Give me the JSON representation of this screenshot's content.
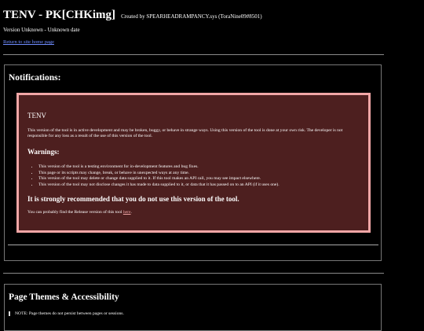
{
  "header": {
    "title": "TENV - PK[CHKimg]",
    "creator": "Created by SPEARHEADRAMPANCY.sys (ToraNine09#8501)",
    "version": "Version Unknown - Unknown date",
    "home_link": "Return to site home page"
  },
  "notifications": {
    "title": "Notifications:",
    "warning": {
      "heading": "TENV",
      "intro": "This version of the tool is in active development and may be broken, buggy, or behave in strange ways. Using this version of the tool is done at your own risk. The developer is not responsible for any loss as a result of the use of this version of the tool.",
      "warnings_title": "Warnings:",
      "items": [
        "This version of the tool is a testing environment for in-development features and bug fixes.",
        "This page or its scripts may change, break, or behave in unexpected ways at any time.",
        "This version of the tool may delete or change data supplied to it. If this tool makes an API call, you may see impact elsewhere.",
        "This version of the tool may not disclose changes it has made to data supplied to it, or data that it has passed on to an API (if it uses one)."
      ],
      "recommendation": "It is strongly recommended that you do not use this version of the tool.",
      "release_prefix": "You can probably find the Release version of this tool ",
      "release_link": "here",
      "release_suffix": "."
    }
  },
  "themes": {
    "title": "Page Themes & Accessibility",
    "note": "NOTE: Page themes do not persist between pages or sessions."
  },
  "colors": {
    "background": "#000000",
    "warning_fill": "#4d1f1f",
    "warning_border": "#f2a6a6",
    "link": "#6f8cff"
  }
}
